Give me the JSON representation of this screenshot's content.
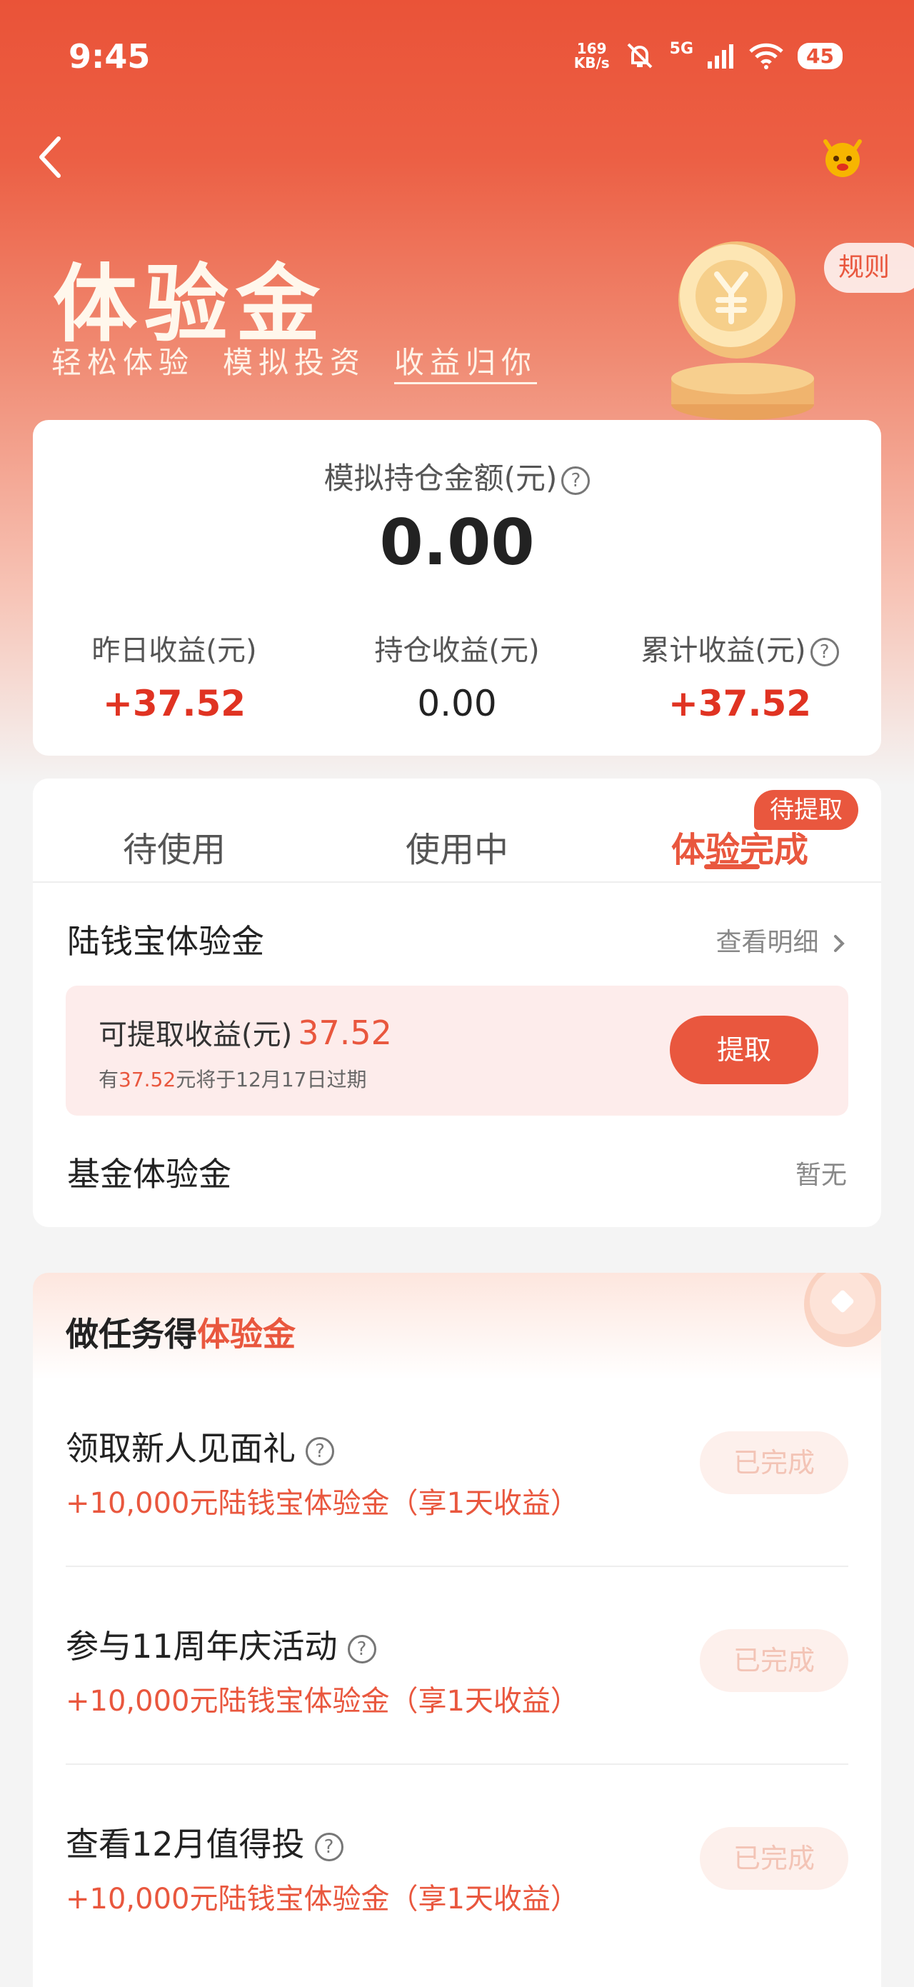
{
  "status_bar": {
    "time": "9:45",
    "net_speed_value": "169",
    "net_speed_unit": "KB/s",
    "network": "5G",
    "battery": "45"
  },
  "header": {
    "back_icon": "chevron-left-icon",
    "mascot_icon": "mascot-icon",
    "rules_label": "规则"
  },
  "hero": {
    "title": "体验金",
    "subtitle_parts": [
      "轻松体验",
      "模拟投资",
      "收益归你"
    ]
  },
  "summary": {
    "label": "模拟持仓金额(元)",
    "amount": "0.00",
    "stats": [
      {
        "label": "昨日收益(元)",
        "value": "+37.52",
        "help": false,
        "red": true
      },
      {
        "label": "持仓收益(元)",
        "value": "0.00",
        "help": false,
        "red": false
      },
      {
        "label": "累计收益(元)",
        "value": "+37.52",
        "help": true,
        "red": true
      }
    ]
  },
  "tabs": {
    "items": [
      "待使用",
      "使用中",
      "体验完成"
    ],
    "active_index": 2,
    "badge": "待提取"
  },
  "lqb": {
    "title": "陆钱宝体验金",
    "link": "查看明细",
    "withdraw_label": "可提取收益(元)",
    "withdraw_amount": "37.52",
    "note_prefix": "有",
    "note_amount": "37.52",
    "note_suffix": "元将于12月17日过期",
    "withdraw_button": "提取"
  },
  "fund": {
    "title": "基金体验金",
    "status": "暂无"
  },
  "tasks": {
    "title_prefix": "做任务得",
    "title_highlight": "体验金",
    "items": [
      {
        "name": "领取新人见面礼",
        "reward": "+10,000元陆钱宝体验金（享1天收益）",
        "button": "已完成"
      },
      {
        "name": "参与11周年庆活动",
        "reward": "+10,000元陆钱宝体验金（享1天收益）",
        "button": "已完成"
      },
      {
        "name": "查看12月值得投",
        "reward": "+10,000元陆钱宝体验金（享1天收益）",
        "button": "已完成"
      }
    ]
  },
  "colors": {
    "brand": "#e9573e",
    "gain_red": "#e03322",
    "hero_top": "#ea5338"
  }
}
